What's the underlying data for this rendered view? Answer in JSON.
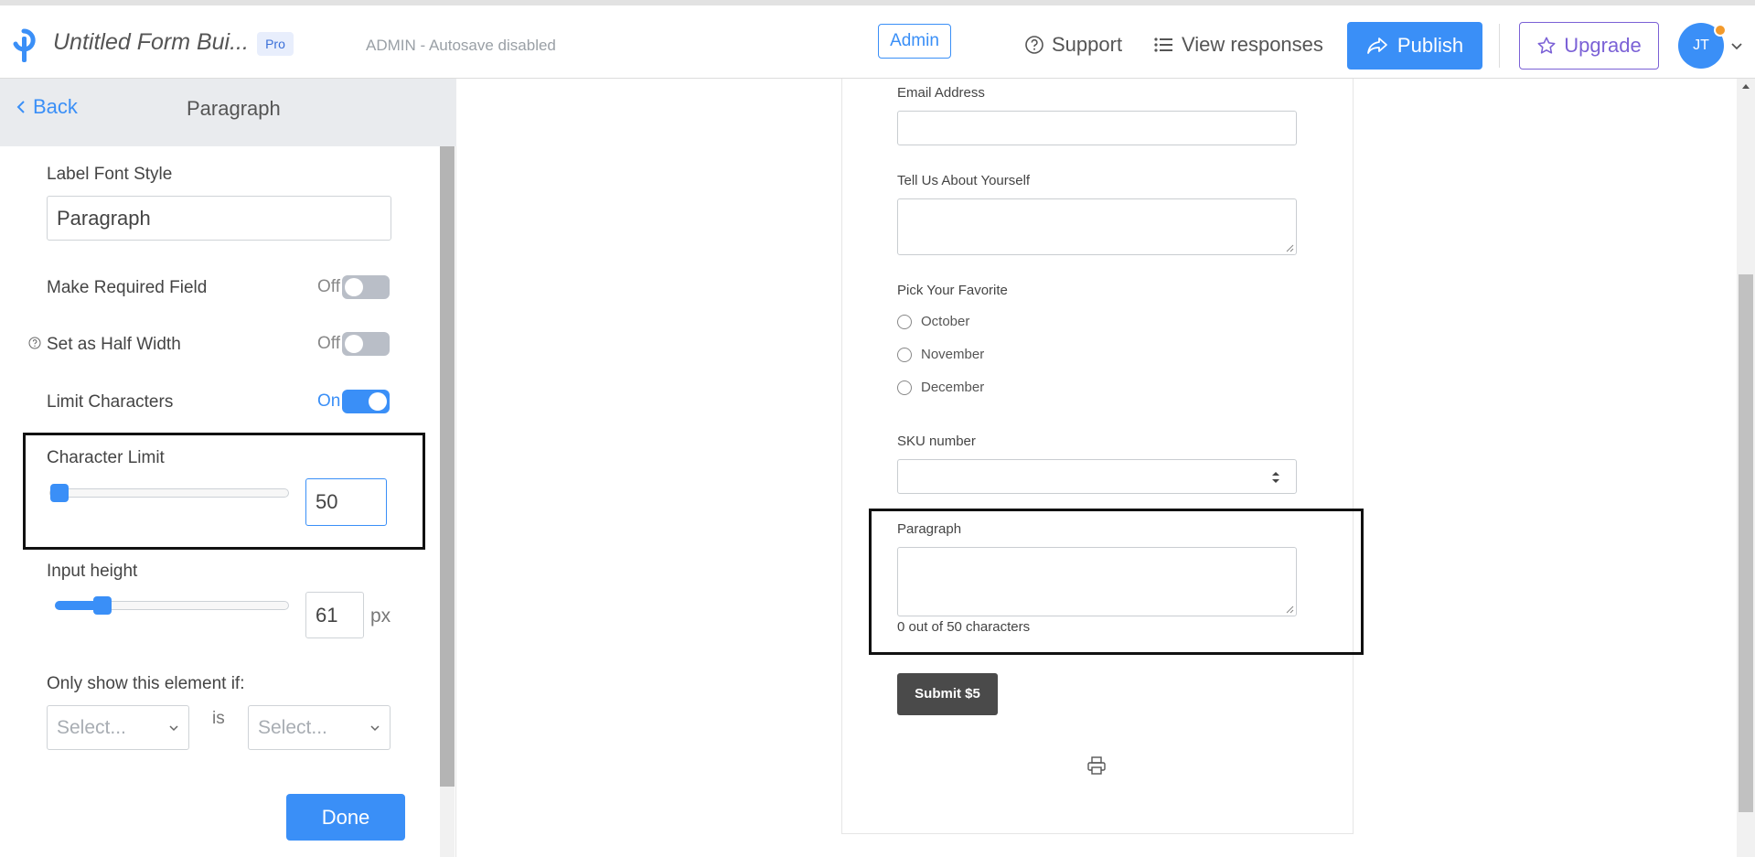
{
  "header": {
    "form_title": "Untitled Form Bui...",
    "pro_badge": "Pro",
    "autosave_status": "ADMIN - Autosave disabled",
    "admin_button": "Admin",
    "support_label": "Support",
    "view_responses_label": "View responses",
    "publish_label": "Publish",
    "upgrade_label": "Upgrade",
    "avatar_initials": "JT"
  },
  "panel": {
    "back_label": "Back",
    "title": "Paragraph",
    "label_font_style": {
      "label": "Label Font Style",
      "value": "Paragraph"
    },
    "make_required": {
      "label": "Make Required Field",
      "state": "Off"
    },
    "half_width": {
      "label": "Set as Half Width",
      "state": "Off"
    },
    "limit_characters": {
      "label": "Limit Characters",
      "state": "On"
    },
    "character_limit": {
      "label": "Character Limit",
      "value": "50"
    },
    "input_height": {
      "label": "Input height",
      "value": "61",
      "unit": "px"
    },
    "conditional": {
      "label": "Only show this element if:",
      "select_placeholder": "Select...",
      "connector": "is",
      "value_placeholder": "Select..."
    },
    "done_label": "Done"
  },
  "form": {
    "email_label": "Email Address",
    "about_label": "Tell Us About Yourself",
    "favorite_label": "Pick Your Favorite",
    "favorite_options": [
      "October",
      "November",
      "December"
    ],
    "sku_label": "SKU number",
    "paragraph_label": "Paragraph",
    "char_counter": "0 out of 50 characters",
    "submit_label": "Submit $5"
  },
  "colors": {
    "accent": "#3a8ff7",
    "upgrade": "#7b61d6",
    "submit": "#4a4a4a"
  }
}
